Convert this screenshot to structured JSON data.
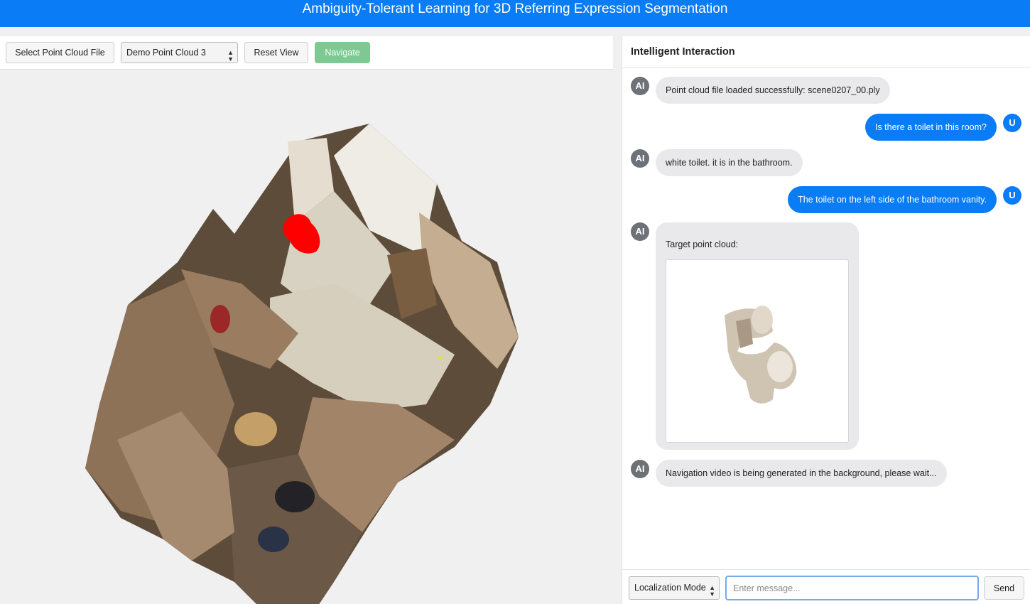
{
  "app": {
    "title": "Ambiguity-Tolerant Learning for 3D Referring Expression Segmentation"
  },
  "toolbar": {
    "select_file_label": "Select Point Cloud File",
    "point_cloud_selected": "Demo Point Cloud 3",
    "reset_view_label": "Reset View",
    "navigate_label": "Navigate"
  },
  "chat": {
    "header": "Intelligent Interaction",
    "avatar_ai": "AI",
    "avatar_user": "U",
    "messages": [
      {
        "role": "ai",
        "text": "Point cloud file loaded successfully: scene0207_00.ply"
      },
      {
        "role": "user",
        "text": "Is there a toilet in this room?"
      },
      {
        "role": "ai",
        "text": "white toilet. it is in the bathroom."
      },
      {
        "role": "user",
        "text": "The toilet on the left side of the bathroom vanity."
      },
      {
        "role": "ai",
        "text": "Target point cloud:"
      },
      {
        "role": "ai",
        "text": "Navigation video is being generated in the background, please wait..."
      }
    ],
    "mode_selected": "Localization Mode",
    "input_placeholder": "Enter message...",
    "send_label": "Send"
  },
  "colors": {
    "accent": "#0a7cf5",
    "navigate_button": "#7ec894",
    "highlight_target": "#ff0000"
  }
}
